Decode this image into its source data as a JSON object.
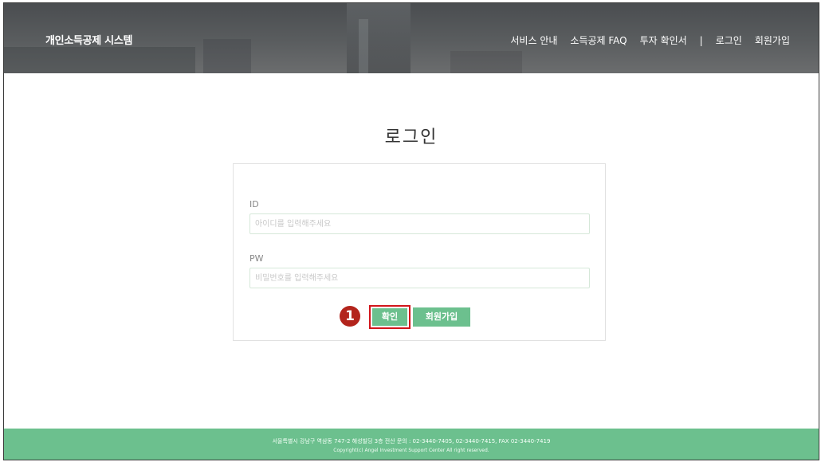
{
  "header": {
    "site_title": "개인소득공제 시스템",
    "nav": {
      "service": "서비스 안내",
      "faq": "소득공제 FAQ",
      "invest": "투자 확인서",
      "separator": "|",
      "login": "로그인",
      "signup": "회원가입"
    }
  },
  "login": {
    "title": "로그인",
    "id_label": "ID",
    "id_placeholder": "아이디를 입력해주세요",
    "pw_label": "PW",
    "pw_placeholder": "비밀번호를 입력해주세요",
    "step_badge": "1",
    "confirm_label": "확인",
    "join_label": "회원가입"
  },
  "footer": {
    "address": "서울특별시 강남구 역삼동 747-2 해성빌딩 3층   전산 문의 : 02-3440-7405, 02-3440-7415,  FAX 02-3440-7419",
    "copyright": "Copyright(c) Angel Investment Support Center All right reserved."
  },
  "colors": {
    "accent": "#6cc08e",
    "highlight": "#d2151b",
    "badge": "#b3241c"
  }
}
